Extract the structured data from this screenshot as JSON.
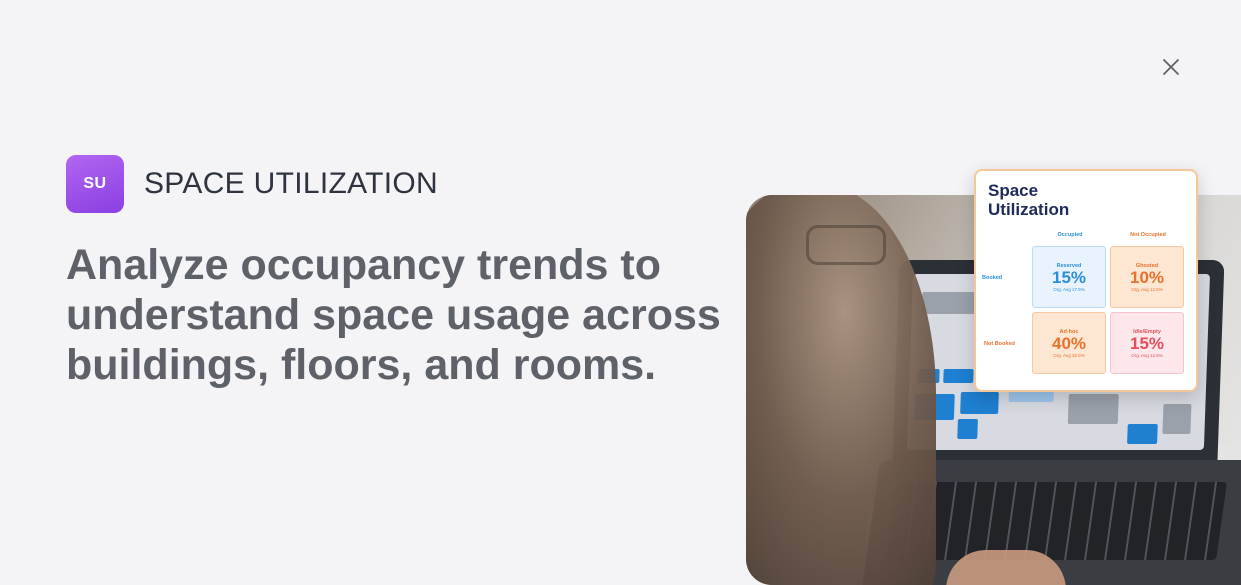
{
  "dialog": {
    "close_icon": "close-icon",
    "close_color": "#5f6169"
  },
  "product": {
    "icon_text": "SU",
    "icon_color": "#9b4fe8",
    "name": "SPACE UTILIZATION"
  },
  "headline": "Analyze occupancy trends to understand space usage across buildings, floors, and rooms.",
  "card": {
    "title": "Space Utilization",
    "columns": [
      "Occupied",
      "Not Occupied"
    ],
    "rows": [
      "Booked",
      "Not Booked"
    ],
    "cells": [
      {
        "label": "Reserved",
        "value": "15%",
        "avg": "Org. Avg 17.5%"
      },
      {
        "label": "Ghosted",
        "value": "10%",
        "avg": "Org. Avg 12.5%"
      },
      {
        "label": "Ad-hoc",
        "value": "40%",
        "avg": "Org. Avg 32.5%"
      },
      {
        "label": "Idle/Empty",
        "value": "15%",
        "avg": "Org. Avg 12.5%"
      }
    ]
  }
}
